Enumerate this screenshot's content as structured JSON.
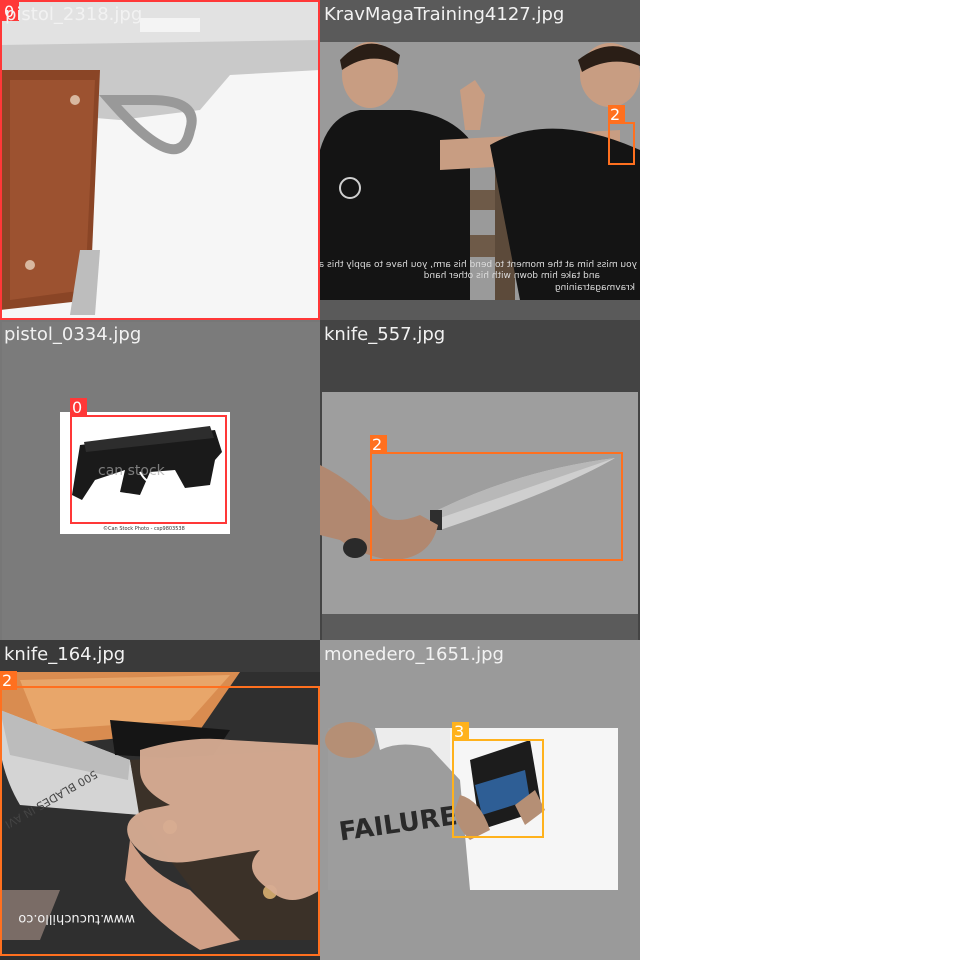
{
  "mosaic": {
    "tiles": [
      {
        "filename": "pistol_2318.jpg",
        "labels": [
          {
            "class_id": "0",
            "color": "#ff3838"
          }
        ]
      },
      {
        "filename": "KravMagaTraining4127.jpg",
        "labels": [
          {
            "class_id": "2",
            "color": "#ff701f"
          }
        ]
      },
      {
        "filename": "pistol_0334.jpg",
        "labels": [
          {
            "class_id": "0",
            "color": "#ff3838"
          }
        ]
      },
      {
        "filename": "knife_557.jpg",
        "labels": [
          {
            "class_id": "2",
            "color": "#ff701f"
          }
        ]
      },
      {
        "filename": "knife_164.jpg",
        "labels": [
          {
            "class_id": "2",
            "color": "#ff701f"
          }
        ]
      },
      {
        "filename": "monedero_1651.jpg",
        "labels": [
          {
            "class_id": "3",
            "color": "#ffb21d"
          }
        ]
      }
    ],
    "image_text": {
      "pistol_stock_watermark": "©Can Stock Photo - csp9803538",
      "pistol_watermark_logo": "can stock",
      "krav_subtitle_1": "you miss him at the moment to bend his arm, you have to apply this arm",
      "krav_subtitle_2": "and take him down with his other hand",
      "krav_website": "kravmagatraining",
      "knife_book_text": "500 BLADES IN AVI",
      "knife_website": "www.tucuchillo.co",
      "shirt_text": "FAILURE"
    }
  }
}
